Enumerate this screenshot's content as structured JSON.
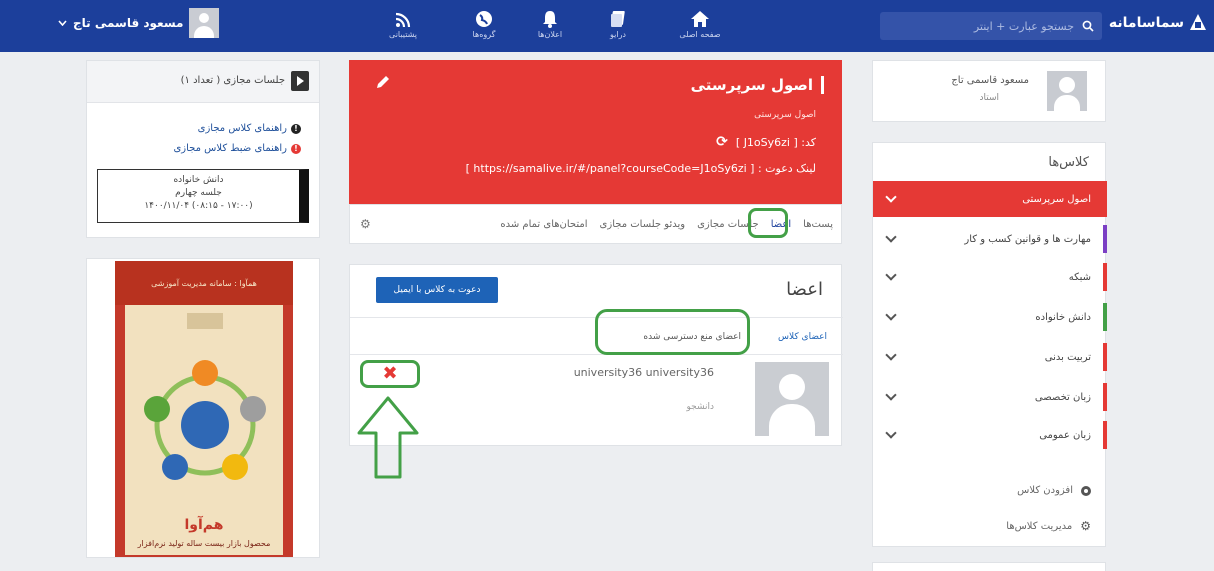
{
  "topbar": {
    "brand": "سماسامانه",
    "search_placeholder": "جستجو عبارت + اینتر",
    "nav": [
      {
        "label": "صفحه اصلی",
        "icon": "home-icon"
      },
      {
        "label": "درایو",
        "icon": "drive-icon"
      },
      {
        "label": "اعلان‌ها",
        "icon": "bell-icon"
      },
      {
        "label": "گروه‌ها",
        "icon": "globe-icon"
      },
      {
        "label": "پشتیبانی",
        "icon": "rss-icon"
      }
    ],
    "user_name": "مسعود قاسمی تاج"
  },
  "profile": {
    "name": "مسعود قاسمی تاج",
    "role": "استاد"
  },
  "classes": {
    "title": "کلاس‌ها",
    "items": [
      {
        "label": "اصول سرپرستی",
        "color": "#e53935",
        "active": true
      },
      {
        "label": "مهارت ها و قوانین کسب و کار",
        "color": "#7b3fc4"
      },
      {
        "label": "شبکه",
        "color": "#e53935"
      },
      {
        "label": "دانش خانواده",
        "color": "#43a047"
      },
      {
        "label": "تربیت بدنی",
        "color": "#e53935"
      },
      {
        "label": "زبان تخصصی",
        "color": "#e53935"
      },
      {
        "label": "زبان عمومی",
        "color": "#e53935"
      }
    ],
    "add_label": "افزودن کلاس",
    "manage_label": "مدیریت کلاس‌ها"
  },
  "course": {
    "title": "اصول سرپرستی",
    "subtitle": "اصول سرپرستی",
    "code_text": "کد: [ J1oSy6zi ]",
    "invite_link_text": "لینک دعوت : [ https://samalive.ir/#/panel?courseCode=J1oSy6zi ]",
    "tabs": [
      "پست‌ها",
      "اعضا",
      "جلسات مجازی",
      "ویدئو جلسات مجازی",
      "امتحان‌های تمام شده"
    ]
  },
  "members": {
    "title": "اعضا",
    "invite_button": "دعوت به کلاس با ایمیل",
    "subtabs": [
      "اعضای کلاس",
      "اعضای منع دسترسی شده"
    ],
    "list": [
      {
        "name": "university36 university36",
        "role": "دانشجو"
      }
    ]
  },
  "virtual_sessions": {
    "header": "جلسات مجازی ( تعداد ۱)",
    "guide1": "راهنمای کلاس مجازی",
    "guide2": "راهنمای ضبط کلاس مجازی",
    "session_course": "دانش خانواده",
    "session_name": "جلسه چهارم",
    "session_time": "۱۴۰۰/۱۱/۰۴ (۰۸:۱۵ - ۱۷:۰۰)"
  },
  "poster": {
    "top_text": "همآوا : سامانه مدیریت آموزشی",
    "title": "هم‌آوا",
    "tagline": "محصول بازار بیست ساله تولید نرم‌افزار"
  }
}
